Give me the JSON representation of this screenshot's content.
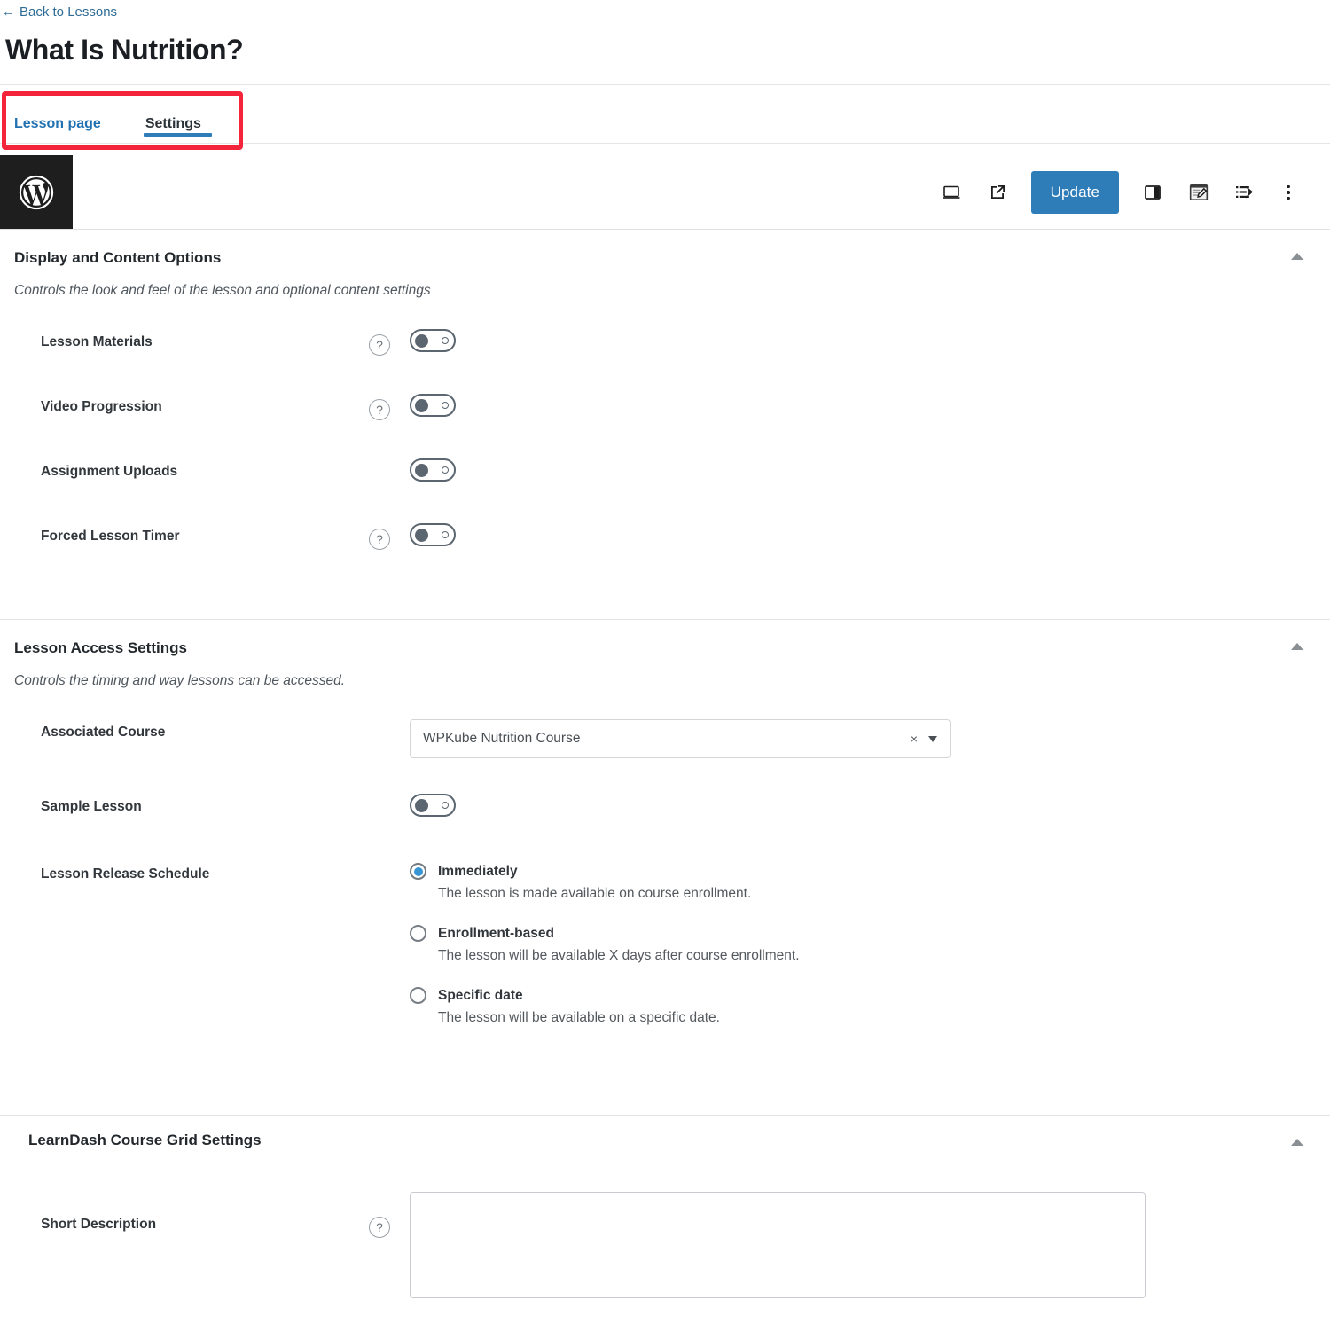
{
  "header": {
    "back_link": "Back to Lessons",
    "back_arrow": "←",
    "title": "What Is Nutrition?"
  },
  "tabs": [
    {
      "label": "Lesson page",
      "active": false
    },
    {
      "label": "Settings",
      "active": true
    }
  ],
  "toolbar": {
    "logo_icon": "wordpress-icon",
    "view_icon": "desktop-preview-icon",
    "external_icon": "view-external-link-icon",
    "update_label": "Update",
    "sidebar_icon": "settings-sidebar-icon",
    "post_icon": "edit-post-icon",
    "listview_icon": "list-view-icon",
    "more_icon": "more-options-icon"
  },
  "colors": {
    "accent_blue": "#2e7cb8",
    "link_blue": "#2271b1",
    "annotation_red": "#f4253a",
    "toggle_gray": "#5b6670"
  },
  "panels": [
    {
      "title": "Display and Content Options",
      "description": "Controls the look and feel of the lesson and optional content settings",
      "collapse_icon": "caret-up-icon",
      "rows": [
        {
          "label": "Lesson Materials",
          "help": true,
          "help_icon": "help-icon",
          "control": "toggle",
          "checked": false
        },
        {
          "label": "Video Progression",
          "help": true,
          "help_icon": "help-icon",
          "control": "toggle",
          "checked": false
        },
        {
          "label": "Assignment Uploads",
          "help": false,
          "control": "toggle",
          "checked": false
        },
        {
          "label": "Forced Lesson Timer",
          "help": true,
          "help_icon": "help-icon",
          "control": "toggle",
          "checked": false
        }
      ]
    },
    {
      "title": "Lesson Access Settings",
      "description": "Controls the timing and way lessons can be accessed.",
      "collapse_icon": "caret-up-icon",
      "rows": [
        {
          "label": "Associated Course",
          "help": false,
          "control": "combo",
          "value": "WPKube Nutrition Course",
          "clear_icon": "×",
          "dropdown_icon": "chevron-down-icon"
        },
        {
          "label": "Sample Lesson",
          "help": false,
          "control": "toggle",
          "checked": false
        },
        {
          "label": "Lesson Release Schedule",
          "help": false,
          "control": "radio",
          "options": [
            {
              "label": "Immediately",
              "desc": "The lesson is made available on course enrollment.",
              "selected": true
            },
            {
              "label": "Enrollment-based",
              "desc": "The lesson will be available X days after course enrollment.",
              "selected": false
            },
            {
              "label": "Specific date",
              "desc": "The lesson will be available on a specific date.",
              "selected": false
            }
          ]
        }
      ]
    },
    {
      "title": "LearnDash Course Grid Settings",
      "description": "",
      "collapse_icon": "caret-up-icon",
      "rows": [
        {
          "label": "Short Description",
          "help": true,
          "help_icon": "help-icon",
          "control": "textarea",
          "value": "",
          "placeholder": ""
        }
      ]
    }
  ]
}
